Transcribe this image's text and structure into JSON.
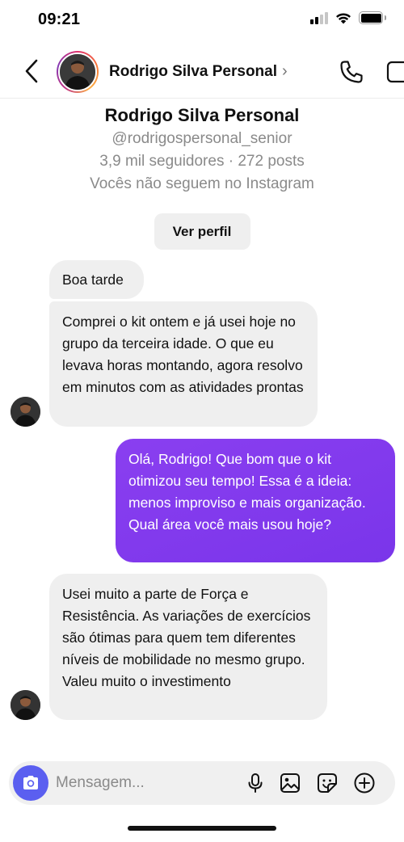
{
  "status_bar": {
    "time": "09:21",
    "icons": [
      "signal-icon",
      "wifi-icon",
      "battery-icon"
    ]
  },
  "header": {
    "back_icon": "chevron-left-icon",
    "contact_name": "Rodrigo Silva Personal",
    "name_chevron": "›",
    "actions": [
      "phone-icon",
      "video-icon"
    ]
  },
  "profile": {
    "name": "Rodrigo Silva Personal",
    "handle": "@rodrigospersonal_senior",
    "stats": "3,9 mil seguidores · 272 posts",
    "follow_status": "Vocês não seguem no Instagram",
    "view_profile_label": "Ver perfil"
  },
  "messages": [
    {
      "direction": "incoming",
      "text": "Boa tarde"
    },
    {
      "direction": "incoming",
      "text": "Comprei o kit ontem e já usei hoje no grupo da terceira idade. O que eu levava horas montando, agora resolvo em minutos com as atividades prontas"
    },
    {
      "direction": "outgoing",
      "text": "Olá, Rodrigo! Que bom que o kit otimizou seu tempo! Essa é a ideia: menos improviso e mais organização. Qual área você mais usou hoje?"
    },
    {
      "direction": "incoming",
      "text": "Usei muito a parte de Força e Resistência. As variações de exercícios são ótimas para quem tem diferentes níveis de mobilidade no mesmo grupo. Valeu muito o investimento"
    }
  ],
  "composer": {
    "placeholder": "Mensagem...",
    "icons": [
      "camera-icon",
      "microphone-icon",
      "gallery-icon",
      "sticker-icon",
      "plus-icon"
    ]
  },
  "colors": {
    "outgoing_bubble": "#7c3aed",
    "incoming_bubble": "#efefef",
    "camera_button": "#5b5ff0"
  }
}
